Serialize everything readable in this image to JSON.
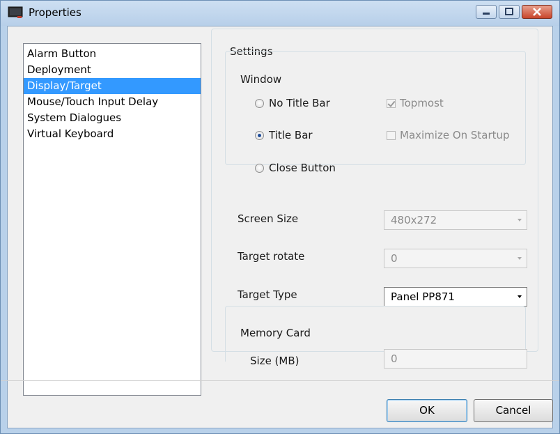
{
  "window": {
    "title": "Properties"
  },
  "nav": {
    "items": [
      {
        "label": "Alarm Button",
        "selected": false
      },
      {
        "label": "Deployment",
        "selected": false
      },
      {
        "label": "Display/Target",
        "selected": true
      },
      {
        "label": "Mouse/Touch Input Delay",
        "selected": false
      },
      {
        "label": "System Dialogues",
        "selected": false
      },
      {
        "label": "Virtual Keyboard",
        "selected": false
      }
    ]
  },
  "settings": {
    "group_label": "Settings",
    "window_group": {
      "label": "Window",
      "radio_no_title_bar": "No Title Bar",
      "radio_title_bar": "Title Bar",
      "radio_close_button": "Close Button",
      "selected_radio": "Title Bar",
      "check_topmost": "Topmost",
      "topmost_checked": true,
      "check_maximize": "Maximize On Startup",
      "maximize_checked": false
    },
    "screen_size": {
      "label": "Screen Size",
      "value": "480x272"
    },
    "target_rotate": {
      "label": "Target rotate",
      "value": "0"
    },
    "target_type": {
      "label": "Target Type",
      "value": "Panel PP871"
    },
    "memory_card": {
      "label": "Memory Card",
      "size_label": "Size (MB)",
      "size_value": "0"
    }
  },
  "buttons": {
    "ok": "OK",
    "cancel": "Cancel"
  },
  "colors": {
    "selection": "#3399ff",
    "titlebar": "#b9d1ea",
    "close_button": "#c8452b"
  }
}
